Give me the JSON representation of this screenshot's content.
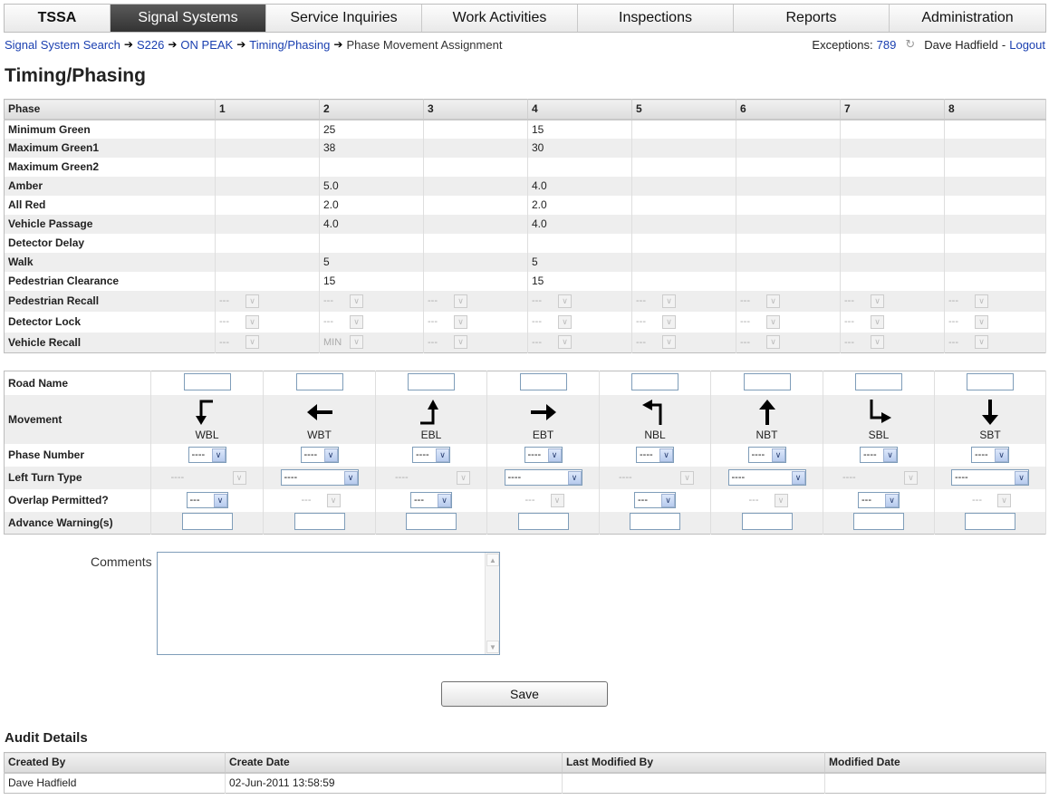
{
  "nav": {
    "tabs": [
      {
        "label": "TSSA",
        "width": 117
      },
      {
        "label": "Signal Systems",
        "width": 172,
        "active": true
      },
      {
        "label": "Service Inquiries",
        "width": 172
      },
      {
        "label": "Work Activities",
        "width": 172
      },
      {
        "label": "Inspections",
        "width": 172
      },
      {
        "label": "Reports",
        "width": 172
      },
      {
        "label": "Administration",
        "width": 172
      }
    ]
  },
  "breadcrumb": {
    "items": [
      "Signal System Search",
      "S226",
      "ON PEAK",
      "Timing/Phasing"
    ],
    "current": "Phase Movement Assignment"
  },
  "userbar": {
    "exceptions_label": "Exceptions:",
    "exceptions_count": "789",
    "user_name": "Dave Hadfield",
    "separator": "-",
    "logout": "Logout"
  },
  "page_title": "Timing/Phasing",
  "timing": {
    "header": [
      "Phase",
      "1",
      "2",
      "3",
      "4",
      "5",
      "6",
      "7",
      "8"
    ],
    "rows": [
      {
        "label": "Minimum Green",
        "values": [
          "",
          "25",
          "",
          "15",
          "",
          "",
          "",
          ""
        ]
      },
      {
        "label": "Maximum Green1",
        "values": [
          "",
          "38",
          "",
          "30",
          "",
          "",
          "",
          ""
        ]
      },
      {
        "label": "Maximum Green2",
        "values": [
          "",
          "",
          "",
          "",
          "",
          "",
          "",
          ""
        ]
      },
      {
        "label": "Amber",
        "values": [
          "",
          "5.0",
          "",
          "4.0",
          "",
          "",
          "",
          ""
        ]
      },
      {
        "label": "All Red",
        "values": [
          "",
          "2.0",
          "",
          "2.0",
          "",
          "",
          "",
          ""
        ]
      },
      {
        "label": "Vehicle Passage",
        "values": [
          "",
          "4.0",
          "",
          "4.0",
          "",
          "",
          "",
          ""
        ]
      },
      {
        "label": "Detector Delay",
        "values": [
          "",
          "",
          "",
          "",
          "",
          "",
          "",
          ""
        ]
      },
      {
        "label": "Walk",
        "values": [
          "",
          "5",
          "",
          "5",
          "",
          "",
          "",
          ""
        ]
      },
      {
        "label": "Pedestrian Clearance",
        "values": [
          "",
          "15",
          "",
          "15",
          "",
          "",
          "",
          ""
        ]
      }
    ],
    "select_rows": [
      {
        "label": "Pedestrian Recall",
        "values": [
          "---",
          "---",
          "---",
          "---",
          "---",
          "---",
          "---",
          "---"
        ]
      },
      {
        "label": "Detector Lock",
        "values": [
          "---",
          "---",
          "---",
          "---",
          "---",
          "---",
          "---",
          "---"
        ]
      },
      {
        "label": "Vehicle Recall",
        "values": [
          "---",
          "MIN",
          "---",
          "---",
          "---",
          "---",
          "---",
          "---"
        ]
      }
    ]
  },
  "movement": {
    "labels": {
      "road": "Road Name",
      "movement": "Movement",
      "phase": "Phase Number",
      "left_turn": "Left Turn Type",
      "overlap": "Overlap Permitted?",
      "advance": "Advance Warning(s)"
    },
    "columns": [
      {
        "code": "WBL",
        "icon": "arrow-wbl-icon",
        "phase": "----",
        "left_turn": "----",
        "left_turn_enabled": false,
        "overlap": "---",
        "overlap_enabled": true
      },
      {
        "code": "WBT",
        "icon": "arrow-wbt-icon",
        "phase": "----",
        "left_turn": "----",
        "left_turn_enabled": true,
        "overlap": "---",
        "overlap_enabled": false
      },
      {
        "code": "EBL",
        "icon": "arrow-ebl-icon",
        "phase": "----",
        "left_turn": "----",
        "left_turn_enabled": false,
        "overlap": "---",
        "overlap_enabled": true
      },
      {
        "code": "EBT",
        "icon": "arrow-ebt-icon",
        "phase": "----",
        "left_turn": "----",
        "left_turn_enabled": true,
        "overlap": "---",
        "overlap_enabled": false
      },
      {
        "code": "NBL",
        "icon": "arrow-nbl-icon",
        "phase": "----",
        "left_turn": "----",
        "left_turn_enabled": false,
        "overlap": "---",
        "overlap_enabled": true
      },
      {
        "code": "NBT",
        "icon": "arrow-nbt-icon",
        "phase": "----",
        "left_turn": "----",
        "left_turn_enabled": true,
        "overlap": "---",
        "overlap_enabled": false
      },
      {
        "code": "SBL",
        "icon": "arrow-sbl-icon",
        "phase": "----",
        "left_turn": "----",
        "left_turn_enabled": false,
        "overlap": "---",
        "overlap_enabled": true
      },
      {
        "code": "SBT",
        "icon": "arrow-sbt-icon",
        "phase": "----",
        "left_turn": "----",
        "left_turn_enabled": true,
        "overlap": "---",
        "overlap_enabled": false
      }
    ]
  },
  "comments": {
    "label": "Comments",
    "value": ""
  },
  "save_label": "Save",
  "audit": {
    "title": "Audit Details",
    "headers": [
      "Created By",
      "Create Date",
      "Last Modified By",
      "Modified Date"
    ],
    "row": [
      "Dave Hadfield",
      "02-Jun-2011 13:58:59",
      "",
      ""
    ]
  },
  "colors": {
    "link": "#1a3fb0",
    "active_tab": "#3a3a3a"
  }
}
